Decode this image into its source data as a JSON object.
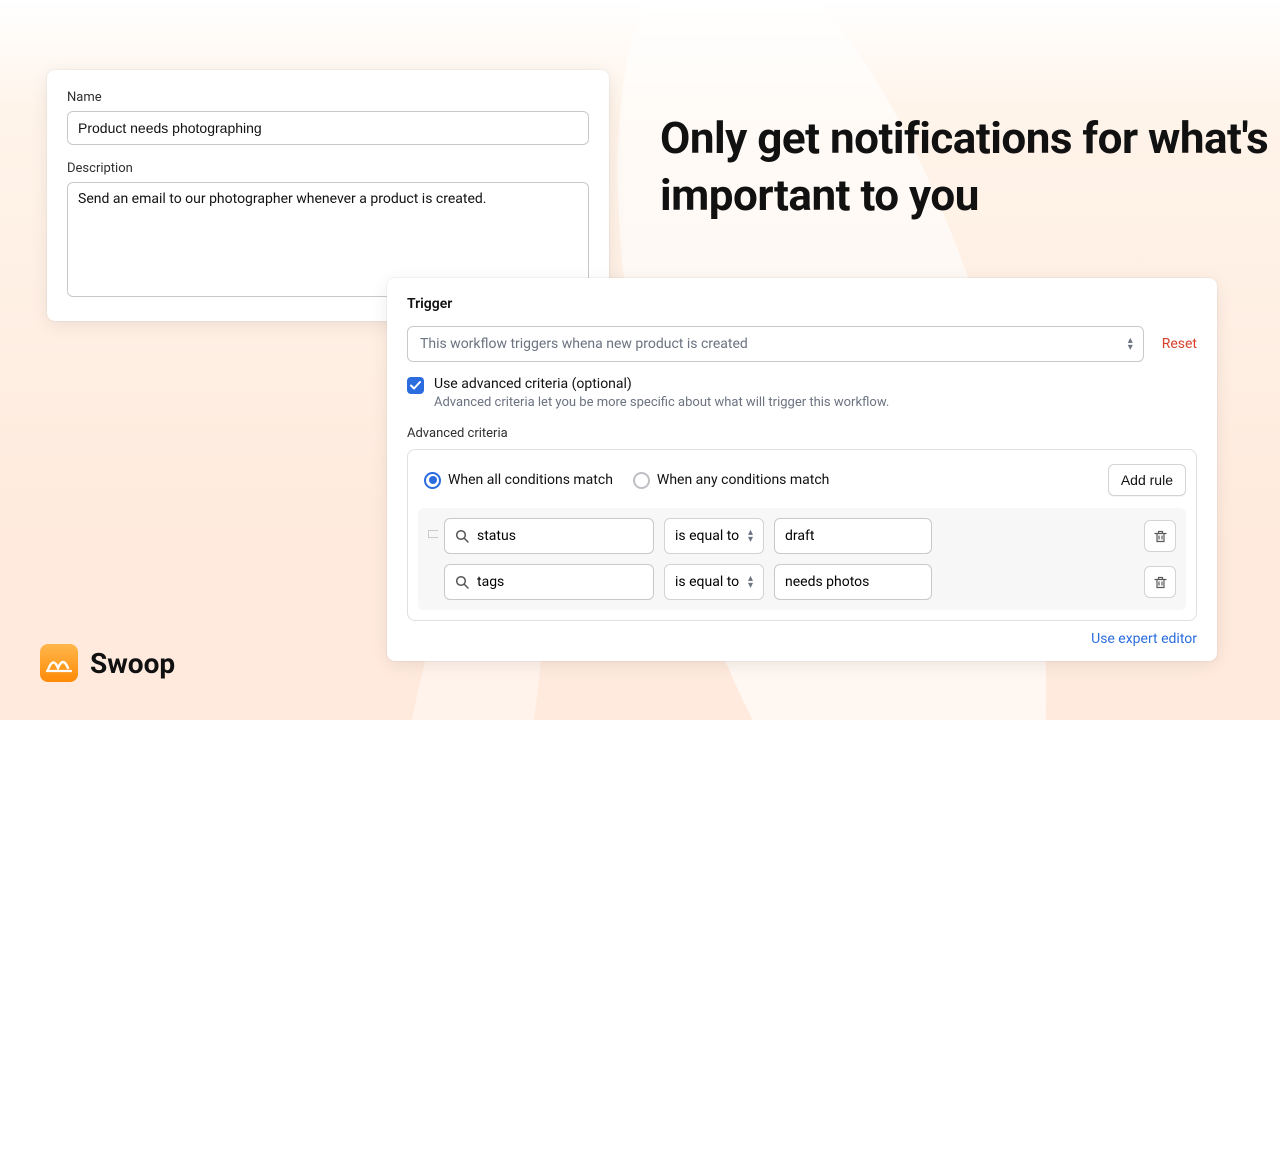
{
  "hero": "Only get notifications for what's important to you",
  "form": {
    "name_label": "Name",
    "name_value": "Product needs photographing",
    "desc_label": "Description",
    "desc_value": "Send an email to our photographer whenever a product is created."
  },
  "trigger": {
    "title": "Trigger",
    "prefix": "This workflow triggers when ",
    "value": "a new product is created",
    "reset": "Reset",
    "advanced_checkbox": "Use advanced criteria (optional)",
    "advanced_help": "Advanced criteria let you be more specific about what will trigger this workflow.",
    "criteria_label": "Advanced criteria",
    "match_all": "When all conditions match",
    "match_any": "When any conditions match",
    "add_rule": "Add rule",
    "expert_link": "Use expert editor"
  },
  "rules": [
    {
      "field": "status",
      "op": "is equal to",
      "value": "draft"
    },
    {
      "field": "tags",
      "op": "is equal to",
      "value": "needs photos"
    }
  ],
  "brand": "Swoop"
}
